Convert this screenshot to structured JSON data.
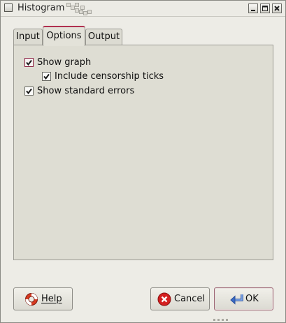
{
  "window": {
    "title": "Histogram"
  },
  "tabs": [
    {
      "label": "Input",
      "active": false
    },
    {
      "label": "Options",
      "active": true
    },
    {
      "label": "Output",
      "active": false
    }
  ],
  "options": {
    "show_graph": {
      "label": "Show graph",
      "checked": true
    },
    "include_censorship_ticks": {
      "label": "Include censorship ticks",
      "checked": true
    },
    "show_standard_errors": {
      "label": "Show standard errors",
      "checked": true
    }
  },
  "buttons": {
    "help": {
      "label": "Help",
      "icon": "lifebuoy-icon"
    },
    "cancel": {
      "label": "Cancel",
      "icon": "cancel-circle-icon"
    },
    "ok": {
      "label": "OK",
      "icon": "return-arrow-icon"
    }
  },
  "colors": {
    "accent": "#b03050",
    "cancel_red": "#d42020",
    "ok_blue": "#3a6cc8"
  }
}
